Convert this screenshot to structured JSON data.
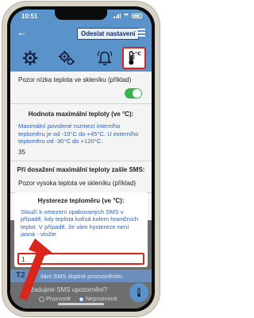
{
  "status": {
    "time": "10:51"
  },
  "header": {
    "send_label": "Odeslat nastavení"
  },
  "tabs": [
    {
      "icon": "gear-icon"
    },
    {
      "icon": "gears-icon"
    },
    {
      "icon": "bell-icon"
    },
    {
      "icon": "thermometer-icon",
      "unit": "°C",
      "active": true
    }
  ],
  "content": {
    "low_sms_example": "Pozor nízka teplota ve skleníku (příklad)",
    "low_toggle_on": true,
    "max_title": "Hodnota maximální teploty (ve °C):",
    "max_hint": "Maximální povolené rozmezí interního teploměru je od -10°C do +45°C. U externího teploměru od -30°C do +120°C.",
    "max_value": "35",
    "max_sms_title": "Při dosažení maximální teploty zašle SMS:",
    "max_sms_example": "Pozor vysoka teplota ve skleníku (příklad)"
  },
  "dialog": {
    "title": "Hystereze teploměru (ve °C):",
    "hint": "Slouží k omezení opakovaných SMS v případě, kdy teplota kolísá kolem hraničních teplot. V případě, že vám hystereze není jasná - vložte",
    "input_value": "1"
  },
  "behind": {
    "badge": "T2",
    "bar_text": "ilání SMS doplnit prozvoněním",
    "question": "Požadujete SMS upozornění?",
    "options": [
      "Prozvonit",
      "Neprozvonit"
    ],
    "selected": 1
  },
  "colors": {
    "primary": "#5a93c9",
    "accent": "#d9261c",
    "toggle": "#38b54a"
  }
}
